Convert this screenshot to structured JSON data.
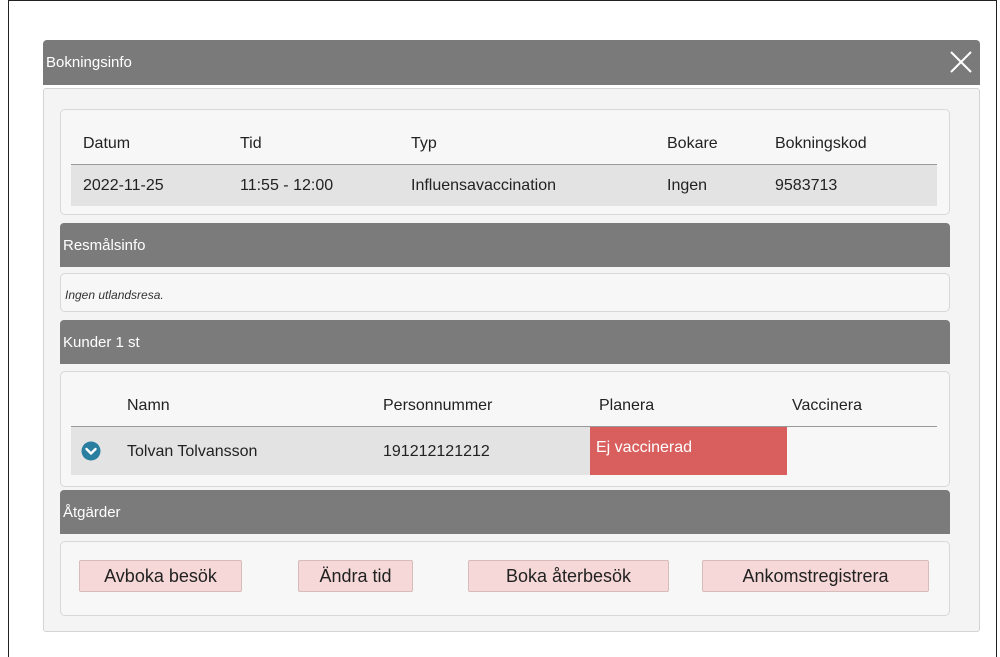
{
  "dialog": {
    "title": "Bokningsinfo",
    "close_icon": "close-x-icon"
  },
  "booking": {
    "headers": [
      "Datum",
      "Tid",
      "Typ",
      "Bokare",
      "Bokningskod"
    ],
    "row": [
      "2022-11-25",
      "11:55 - 12:00",
      "Influensavaccination",
      "Ingen",
      "9583713"
    ]
  },
  "destination": {
    "section_title": "Resmålsinfo",
    "note": "Ingen utlandsresa."
  },
  "customers": {
    "section_title": "Kunder 1 st",
    "headers": [
      "Namn",
      "Personnummer",
      "Planera",
      "Vaccinera"
    ],
    "rows": [
      {
        "expand_icon": "chevron-down-circle-icon",
        "name": "Tolvan Tolvansson",
        "personnummer": "191212121212",
        "planera": "Ej vaccinerad",
        "vaccinera": ""
      }
    ]
  },
  "actions": {
    "section_title": "Åtgärder",
    "buttons": [
      "Avboka besök",
      "Ändra tid",
      "Boka återbesök",
      "Ankomstregistrera"
    ]
  },
  "colors": {
    "header_bar": "#7b7b7b",
    "status_not_vaccinated": "#d95f5f",
    "action_button_bg": "#f6d8d8",
    "expand_icon": "#2a7fa0"
  }
}
